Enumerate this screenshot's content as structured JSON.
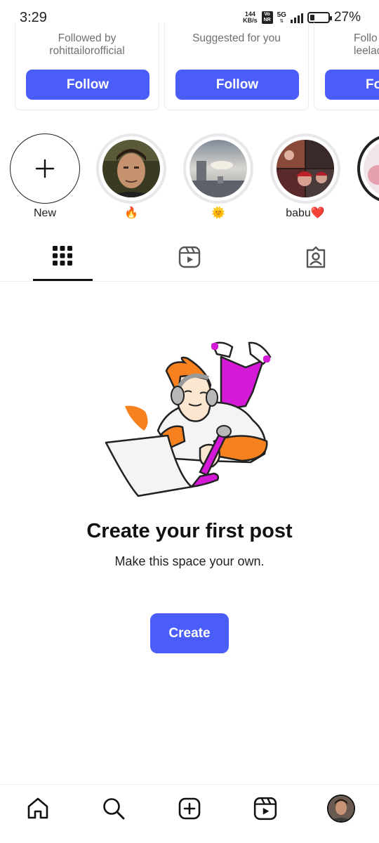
{
  "status_bar": {
    "time": "3:29",
    "net_speed_value": "144",
    "net_speed_unit": "KB/s",
    "volte_badge": "Vo NR",
    "network_type": "5G",
    "battery_percent_text": "27%",
    "battery_level": 0.27
  },
  "suggested_cards": [
    {
      "subtitle_line1": "Followed by",
      "subtitle_line2": "rohittailorofficial",
      "follow_label": "Follow"
    },
    {
      "subtitle_line1": "Suggested for you",
      "subtitle_line2": "",
      "follow_label": "Follow"
    },
    {
      "subtitle_line1": "Follo",
      "subtitle_line2": "leelad",
      "follow_label": "Fo"
    }
  ],
  "highlights": [
    {
      "label": "New",
      "icon": "plus-icon"
    },
    {
      "label": "🔥",
      "icon": "portrait-photo"
    },
    {
      "label": "🌞",
      "icon": "sky-photo"
    },
    {
      "label": "babu❤️",
      "icon": "collage-photo"
    },
    {
      "label": "",
      "icon": "partial-photo"
    }
  ],
  "tabs": [
    {
      "name": "posts",
      "icon": "grid-icon",
      "active": true
    },
    {
      "name": "reels",
      "icon": "reels-icon",
      "active": false
    },
    {
      "name": "tagged",
      "icon": "tagged-person-icon",
      "active": false
    }
  ],
  "empty_state": {
    "title": "Create your first post",
    "subtitle": "Make this space your own.",
    "create_label": "Create"
  },
  "bottom_nav": [
    {
      "name": "home",
      "icon": "home-icon"
    },
    {
      "name": "search",
      "icon": "search-icon"
    },
    {
      "name": "create",
      "icon": "plus-square-icon"
    },
    {
      "name": "reels",
      "icon": "reels-icon"
    },
    {
      "name": "profile",
      "icon": "avatar"
    }
  ],
  "colors": {
    "primary_button": "#4a5df9",
    "illustration_orange": "#f7811e",
    "illustration_magenta": "#d41ad6",
    "text_primary": "#111111",
    "text_secondary": "#6f6f6f"
  }
}
